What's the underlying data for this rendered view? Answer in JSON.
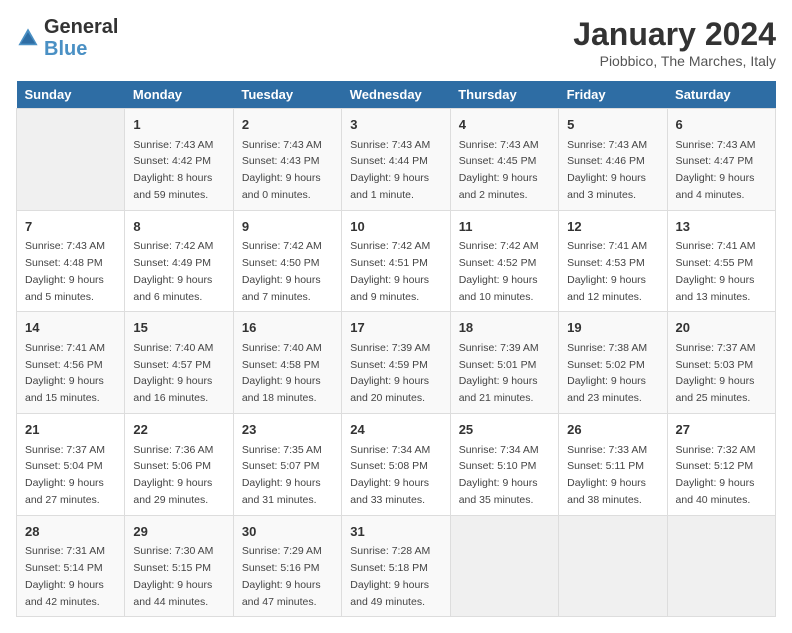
{
  "header": {
    "logo_general": "General",
    "logo_blue": "Blue",
    "month_year": "January 2024",
    "location": "Piobbico, The Marches, Italy"
  },
  "weekdays": [
    "Sunday",
    "Monday",
    "Tuesday",
    "Wednesday",
    "Thursday",
    "Friday",
    "Saturday"
  ],
  "weeks": [
    [
      {
        "day": "",
        "info": ""
      },
      {
        "day": "1",
        "info": "Sunrise: 7:43 AM\nSunset: 4:42 PM\nDaylight: 8 hours\nand 59 minutes."
      },
      {
        "day": "2",
        "info": "Sunrise: 7:43 AM\nSunset: 4:43 PM\nDaylight: 9 hours\nand 0 minutes."
      },
      {
        "day": "3",
        "info": "Sunrise: 7:43 AM\nSunset: 4:44 PM\nDaylight: 9 hours\nand 1 minute."
      },
      {
        "day": "4",
        "info": "Sunrise: 7:43 AM\nSunset: 4:45 PM\nDaylight: 9 hours\nand 2 minutes."
      },
      {
        "day": "5",
        "info": "Sunrise: 7:43 AM\nSunset: 4:46 PM\nDaylight: 9 hours\nand 3 minutes."
      },
      {
        "day": "6",
        "info": "Sunrise: 7:43 AM\nSunset: 4:47 PM\nDaylight: 9 hours\nand 4 minutes."
      }
    ],
    [
      {
        "day": "7",
        "info": "Sunrise: 7:43 AM\nSunset: 4:48 PM\nDaylight: 9 hours\nand 5 minutes."
      },
      {
        "day": "8",
        "info": "Sunrise: 7:42 AM\nSunset: 4:49 PM\nDaylight: 9 hours\nand 6 minutes."
      },
      {
        "day": "9",
        "info": "Sunrise: 7:42 AM\nSunset: 4:50 PM\nDaylight: 9 hours\nand 7 minutes."
      },
      {
        "day": "10",
        "info": "Sunrise: 7:42 AM\nSunset: 4:51 PM\nDaylight: 9 hours\nand 9 minutes."
      },
      {
        "day": "11",
        "info": "Sunrise: 7:42 AM\nSunset: 4:52 PM\nDaylight: 9 hours\nand 10 minutes."
      },
      {
        "day": "12",
        "info": "Sunrise: 7:41 AM\nSunset: 4:53 PM\nDaylight: 9 hours\nand 12 minutes."
      },
      {
        "day": "13",
        "info": "Sunrise: 7:41 AM\nSunset: 4:55 PM\nDaylight: 9 hours\nand 13 minutes."
      }
    ],
    [
      {
        "day": "14",
        "info": "Sunrise: 7:41 AM\nSunset: 4:56 PM\nDaylight: 9 hours\nand 15 minutes."
      },
      {
        "day": "15",
        "info": "Sunrise: 7:40 AM\nSunset: 4:57 PM\nDaylight: 9 hours\nand 16 minutes."
      },
      {
        "day": "16",
        "info": "Sunrise: 7:40 AM\nSunset: 4:58 PM\nDaylight: 9 hours\nand 18 minutes."
      },
      {
        "day": "17",
        "info": "Sunrise: 7:39 AM\nSunset: 4:59 PM\nDaylight: 9 hours\nand 20 minutes."
      },
      {
        "day": "18",
        "info": "Sunrise: 7:39 AM\nSunset: 5:01 PM\nDaylight: 9 hours\nand 21 minutes."
      },
      {
        "day": "19",
        "info": "Sunrise: 7:38 AM\nSunset: 5:02 PM\nDaylight: 9 hours\nand 23 minutes."
      },
      {
        "day": "20",
        "info": "Sunrise: 7:37 AM\nSunset: 5:03 PM\nDaylight: 9 hours\nand 25 minutes."
      }
    ],
    [
      {
        "day": "21",
        "info": "Sunrise: 7:37 AM\nSunset: 5:04 PM\nDaylight: 9 hours\nand 27 minutes."
      },
      {
        "day": "22",
        "info": "Sunrise: 7:36 AM\nSunset: 5:06 PM\nDaylight: 9 hours\nand 29 minutes."
      },
      {
        "day": "23",
        "info": "Sunrise: 7:35 AM\nSunset: 5:07 PM\nDaylight: 9 hours\nand 31 minutes."
      },
      {
        "day": "24",
        "info": "Sunrise: 7:34 AM\nSunset: 5:08 PM\nDaylight: 9 hours\nand 33 minutes."
      },
      {
        "day": "25",
        "info": "Sunrise: 7:34 AM\nSunset: 5:10 PM\nDaylight: 9 hours\nand 35 minutes."
      },
      {
        "day": "26",
        "info": "Sunrise: 7:33 AM\nSunset: 5:11 PM\nDaylight: 9 hours\nand 38 minutes."
      },
      {
        "day": "27",
        "info": "Sunrise: 7:32 AM\nSunset: 5:12 PM\nDaylight: 9 hours\nand 40 minutes."
      }
    ],
    [
      {
        "day": "28",
        "info": "Sunrise: 7:31 AM\nSunset: 5:14 PM\nDaylight: 9 hours\nand 42 minutes."
      },
      {
        "day": "29",
        "info": "Sunrise: 7:30 AM\nSunset: 5:15 PM\nDaylight: 9 hours\nand 44 minutes."
      },
      {
        "day": "30",
        "info": "Sunrise: 7:29 AM\nSunset: 5:16 PM\nDaylight: 9 hours\nand 47 minutes."
      },
      {
        "day": "31",
        "info": "Sunrise: 7:28 AM\nSunset: 5:18 PM\nDaylight: 9 hours\nand 49 minutes."
      },
      {
        "day": "",
        "info": ""
      },
      {
        "day": "",
        "info": ""
      },
      {
        "day": "",
        "info": ""
      }
    ]
  ]
}
